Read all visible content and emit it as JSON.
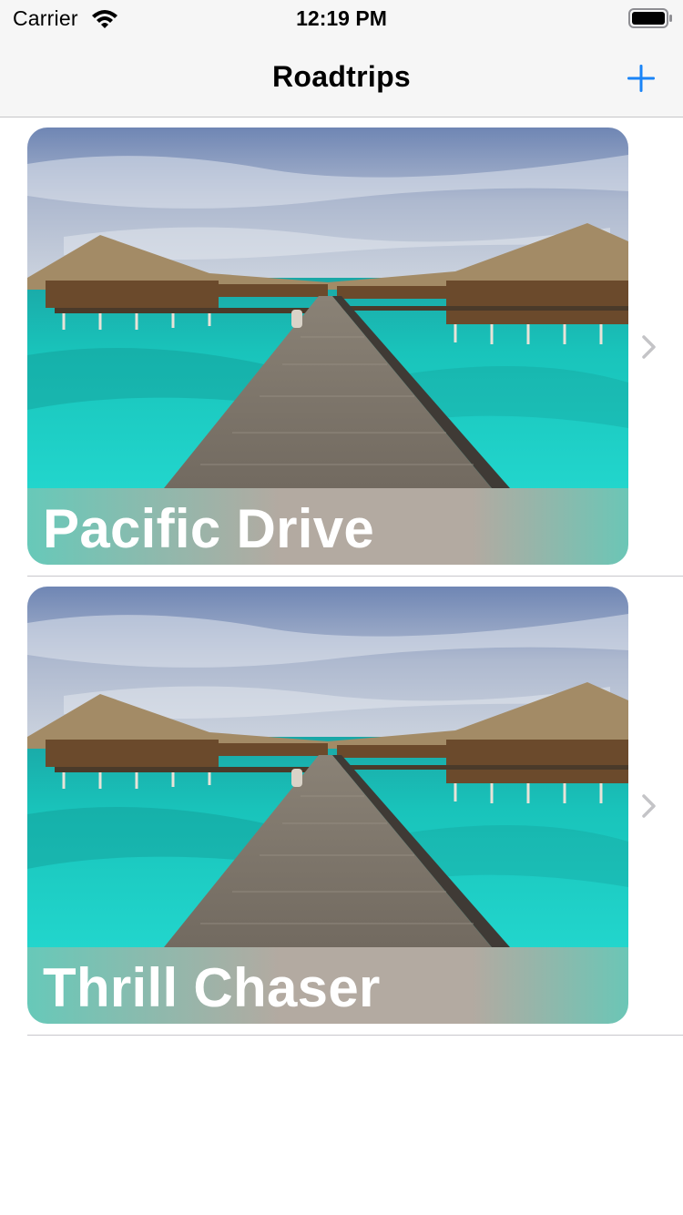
{
  "status_bar": {
    "carrier": "Carrier",
    "time": "12:19 PM",
    "icons": [
      "wifi-icon",
      "battery-icon"
    ]
  },
  "nav_bar": {
    "title": "Roadtrips",
    "add_button_icon": "plus-icon",
    "accent_color": "#1a84f7"
  },
  "trips": [
    {
      "title": "Pacific Drive",
      "image": "overwater-bungalows-boardwalk-photo",
      "disclosure_icon": "chevron-right-icon"
    },
    {
      "title": "Thrill Chaser",
      "image": "overwater-bungalows-boardwalk-photo",
      "disclosure_icon": "chevron-right-icon"
    }
  ]
}
